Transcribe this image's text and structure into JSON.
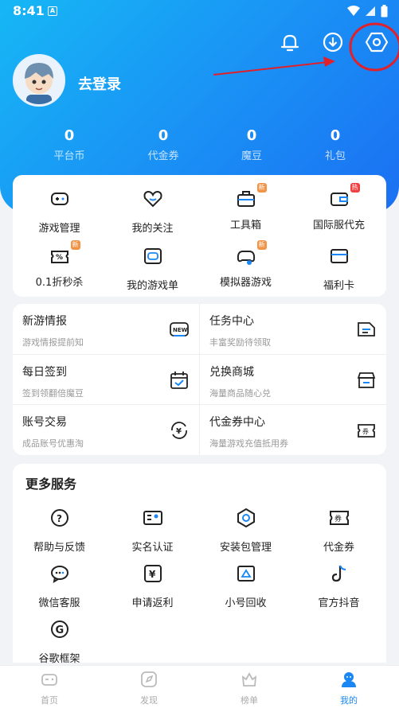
{
  "status": {
    "time": "8:41",
    "a_icon": "A"
  },
  "profile": {
    "login_label": "去登录"
  },
  "stats": [
    {
      "value": "0",
      "label": "平台币"
    },
    {
      "value": "0",
      "label": "代金券"
    },
    {
      "value": "0",
      "label": "魔豆"
    },
    {
      "value": "0",
      "label": "礼包"
    }
  ],
  "quick": [
    {
      "label": "游戏管理",
      "icon": "gamepad-icon"
    },
    {
      "label": "我的关注",
      "icon": "heart-icon"
    },
    {
      "label": "工具箱",
      "icon": "toolbox-icon",
      "badge": "新"
    },
    {
      "label": "国际服代充",
      "icon": "wallet-icon",
      "badge": "热"
    },
    {
      "label": "0.1折秒杀",
      "icon": "discount-icon",
      "badge": "新"
    },
    {
      "label": "我的游戏单",
      "icon": "game-list-icon"
    },
    {
      "label": "模拟器游戏",
      "icon": "emulator-icon",
      "badge": "新"
    },
    {
      "label": "福利卡",
      "icon": "card-icon"
    }
  ],
  "features": [
    {
      "title": "新游情报",
      "sub": "游戏情报提前知",
      "icon": "new-icon",
      "icon_text": "NEW"
    },
    {
      "title": "任务中心",
      "sub": "丰富奖励待领取",
      "icon": "task-icon"
    },
    {
      "title": "每日签到",
      "sub": "签到领翻倍魔豆",
      "icon": "calendar-icon"
    },
    {
      "title": "兑换商城",
      "sub": "海量商品随心兑",
      "icon": "shop-icon"
    },
    {
      "title": "账号交易",
      "sub": "成品账号优惠淘",
      "icon": "trade-icon",
      "icon_text": "¥"
    },
    {
      "title": "代金券中心",
      "sub": "海量游戏充值抵用券",
      "icon": "coupon-icon",
      "icon_text": "券"
    }
  ],
  "more": {
    "title": "更多服务",
    "items": [
      {
        "label": "帮助与反馈",
        "icon": "help-icon"
      },
      {
        "label": "实名认证",
        "icon": "id-card-icon"
      },
      {
        "label": "安装包管理",
        "icon": "package-icon"
      },
      {
        "label": "代金券",
        "icon": "voucher-icon",
        "icon_text": "券"
      },
      {
        "label": "微信客服",
        "icon": "wechat-icon"
      },
      {
        "label": "申请返利",
        "icon": "rebate-icon",
        "icon_text": "¥"
      },
      {
        "label": "小号回收",
        "icon": "recycle-icon"
      },
      {
        "label": "官方抖音",
        "icon": "tiktok-icon"
      },
      {
        "label": "谷歌框架",
        "icon": "google-icon",
        "icon_text": "G"
      }
    ]
  },
  "tabs": [
    {
      "label": "首页",
      "icon": "home-icon"
    },
    {
      "label": "发现",
      "icon": "discover-icon"
    },
    {
      "label": "榜单",
      "icon": "ranking-icon"
    },
    {
      "label": "我的",
      "icon": "profile-icon",
      "active": true
    }
  ],
  "colors": {
    "primary": "#1a87f5",
    "annotation_red": "#e0202a",
    "badge_orange": "#f29446"
  }
}
